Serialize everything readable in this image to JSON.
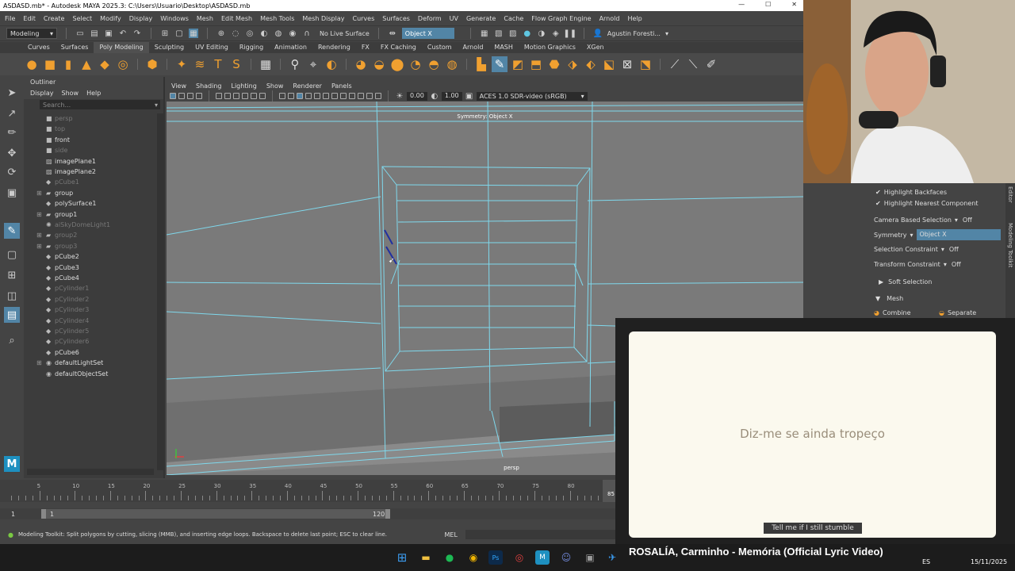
{
  "window": {
    "title": "ASDASD.mb* - Autodesk MAYA 2025.3: C:\\Users\\Usuario\\Desktop\\ASDASD.mb"
  },
  "menubar": [
    "File",
    "Edit",
    "Create",
    "Select",
    "Modify",
    "Display",
    "Windows",
    "Mesh",
    "Edit Mesh",
    "Mesh Tools",
    "Mesh Display",
    "Curves",
    "Surfaces",
    "Deform",
    "UV",
    "Generate",
    "Cache",
    "Flow Graph Engine",
    "Arnold",
    "Help"
  ],
  "statusline": {
    "mode": "Modeling",
    "live_surface": "No Live Surface",
    "symmetry": "Object X",
    "user": "Agustin Foresti..."
  },
  "shelf_tabs": [
    "Curves",
    "Surfaces",
    "Poly Modeling",
    "Sculpting",
    "UV Editing",
    "Rigging",
    "Animation",
    "Rendering",
    "FX",
    "FX Caching",
    "Custom",
    "Arnold",
    "MASH",
    "Motion Graphics",
    "XGen"
  ],
  "shelf_active": "Poly Modeling",
  "outliner": {
    "title": "Outliner",
    "menus": [
      "Display",
      "Show",
      "Help"
    ],
    "search_placeholder": "Search...",
    "items": [
      {
        "label": "persp",
        "dim": true,
        "exp": false,
        "icon": "camera-icon"
      },
      {
        "label": "top",
        "dim": true,
        "exp": false,
        "icon": "camera-icon"
      },
      {
        "label": "front",
        "dim": false,
        "exp": false,
        "icon": "camera-icon"
      },
      {
        "label": "side",
        "dim": true,
        "exp": false,
        "icon": "camera-icon"
      },
      {
        "label": "imagePlane1",
        "dim": false,
        "exp": false,
        "icon": "image-plane-icon"
      },
      {
        "label": "imagePlane2",
        "dim": false,
        "exp": false,
        "icon": "image-plane-icon"
      },
      {
        "label": "pCube1",
        "dim": true,
        "exp": false,
        "icon": "mesh-icon"
      },
      {
        "label": "group",
        "dim": false,
        "exp": true,
        "icon": "group-icon"
      },
      {
        "label": "polySurface1",
        "dim": false,
        "exp": false,
        "icon": "mesh-icon"
      },
      {
        "label": "group1",
        "dim": false,
        "exp": true,
        "icon": "group-icon"
      },
      {
        "label": "aiSkyDomeLight1",
        "dim": true,
        "exp": false,
        "icon": "light-icon"
      },
      {
        "label": "group2",
        "dim": true,
        "exp": true,
        "icon": "group-icon"
      },
      {
        "label": "group3",
        "dim": true,
        "exp": true,
        "icon": "group-icon"
      },
      {
        "label": "pCube2",
        "dim": false,
        "exp": false,
        "icon": "mesh-icon"
      },
      {
        "label": "pCube3",
        "dim": false,
        "exp": false,
        "icon": "mesh-icon"
      },
      {
        "label": "pCube4",
        "dim": false,
        "exp": false,
        "icon": "mesh-icon"
      },
      {
        "label": "pCylinder1",
        "dim": true,
        "exp": false,
        "icon": "mesh-icon"
      },
      {
        "label": "pCylinder2",
        "dim": true,
        "exp": false,
        "icon": "mesh-icon"
      },
      {
        "label": "pCylinder3",
        "dim": true,
        "exp": false,
        "icon": "mesh-icon"
      },
      {
        "label": "pCylinder4",
        "dim": true,
        "exp": false,
        "icon": "mesh-icon"
      },
      {
        "label": "pCylinder5",
        "dim": true,
        "exp": false,
        "icon": "mesh-icon"
      },
      {
        "label": "pCylinder6",
        "dim": true,
        "exp": false,
        "icon": "mesh-icon"
      },
      {
        "label": "pCube6",
        "dim": false,
        "exp": false,
        "icon": "mesh-icon"
      },
      {
        "label": "defaultLightSet",
        "dim": false,
        "exp": true,
        "icon": "set-icon"
      },
      {
        "label": "defaultObjectSet",
        "dim": false,
        "exp": false,
        "icon": "set-icon"
      }
    ]
  },
  "viewport": {
    "menus": [
      "View",
      "Shading",
      "Lighting",
      "Show",
      "Renderer",
      "Panels"
    ],
    "exposure": "0.00",
    "gamma": "1.00",
    "colorspace": "ACES 1.0 SDR-video (sRGB)",
    "symmetry_label": "Symmetry: Object X",
    "camera_label": "persp"
  },
  "timeline": {
    "ticks": [
      "5",
      "10",
      "15",
      "20",
      "25",
      "30",
      "35",
      "40",
      "45",
      "50",
      "55",
      "60",
      "65",
      "70",
      "75",
      "80",
      "85"
    ],
    "current_frame": "85",
    "range_start": "1",
    "range_start_inner": "1",
    "range_end": "120"
  },
  "helpline": {
    "text": "Modeling Toolkit: Split polygons by cutting, slicing (MMB), and inserting edge loops. Backspace to delete last point; ESC to clear line.",
    "mel": "MEL"
  },
  "modeling_toolkit": {
    "highlight_backfaces": "Highlight Backfaces",
    "highlight_nearest": "Highlight Nearest Component",
    "camera_based_label": "Camera Based Selection",
    "camera_based_value": "Off",
    "symmetry_label": "Symmetry",
    "symmetry_value": "Object X",
    "selection_constraint_label": "Selection Constraint",
    "selection_constraint_value": "Off",
    "transform_constraint_label": "Transform Constraint",
    "transform_constraint_value": "Off",
    "soft_selection": "Soft Selection",
    "mesh": "Mesh",
    "combine": "Combine",
    "separate": "Separate",
    "side_tabs": [
      "Attribute Editor",
      "Modeling Toolkit"
    ]
  },
  "video": {
    "lyric": "Diz-me se ainda tropeço",
    "subtitle": "Tell me if I still stumble",
    "title": "ROSALÍA, Carminho - Memória (Official Lyric Video)"
  },
  "taskbar": {
    "lang": "ES",
    "date": "15/11/2025"
  },
  "colors": {
    "accent": "#5285a6",
    "wire": "#7fd8ec",
    "bg": "#444444",
    "viewport": "#7a7a7a"
  }
}
